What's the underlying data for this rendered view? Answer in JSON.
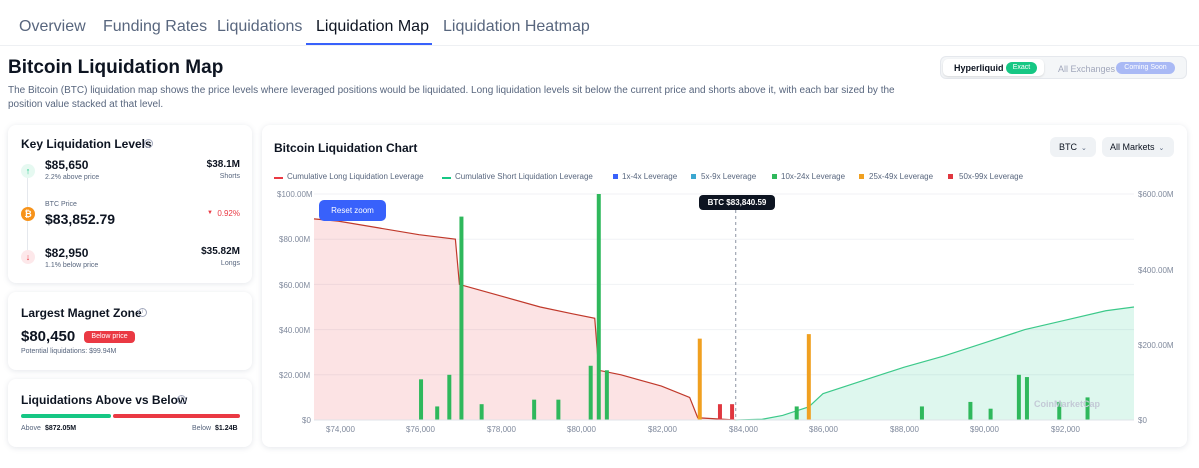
{
  "tabs": [
    {
      "label": "Overview"
    },
    {
      "label": "Funding Rates"
    },
    {
      "label": "Liquidations"
    },
    {
      "label": "Liquidation Map",
      "active": true
    },
    {
      "label": "Liquidation Heatmap"
    }
  ],
  "page": {
    "title": "Bitcoin Liquidation Map",
    "description": "The Bitcoin (BTC) liquidation map shows the price levels where leveraged positions would be liquidated. Long liquidation levels sit below the current price and shorts above it, with each bar sized by the position value stacked at that level."
  },
  "source_toggle": {
    "hyperliquid": "Hyperliquid",
    "exact_badge": "Exact",
    "all_exchanges": "All Exchanges",
    "coming_soon": "Coming Soon"
  },
  "key_levels": {
    "title": "Key Liquidation Levels",
    "upper": {
      "price": "$85,650",
      "sub": "2.2% above price",
      "value": "$38.1M",
      "value_label": "Shorts"
    },
    "current": {
      "label": "BTC Price",
      "price": "$83,852.79",
      "change": "0.92%"
    },
    "lower": {
      "price": "$82,950",
      "sub": "1.1% below price",
      "value": "$35.82M",
      "value_label": "Longs"
    }
  },
  "magnet": {
    "title": "Largest Magnet Zone",
    "price": "$80,450",
    "badge": "Below price",
    "potential": "Potential liquidations: $99.94M"
  },
  "above_below": {
    "title": "Liquidations Above vs Below",
    "above_label": "Above",
    "above_value": "$872.05M",
    "below_label": "Below",
    "below_value": "$1.24B",
    "above_fraction": 0.41
  },
  "chart": {
    "title": "Bitcoin Liquidation Chart",
    "coin_select": "BTC",
    "market_select": "All Markets",
    "reset_zoom": "Reset zoom",
    "price_tag": "BTC $83,840.59",
    "watermark": "CoinMarketCap",
    "left_ticks": [
      "$100.00M",
      "$80.00M",
      "$60.00M",
      "$40.00M",
      "$20.00M",
      "$0"
    ],
    "right_ticks": [
      "$600.00M",
      "$400.00M",
      "$200.00M",
      "$0"
    ],
    "x_ticks": [
      "$74,000",
      "$76,000",
      "$78,000",
      "$80,000",
      "$82,000",
      "$84,000",
      "$86,000",
      "$88,000",
      "$90,000",
      "$92,000"
    ],
    "legend": [
      {
        "label": "Cumulative Long Liquidation Leverage",
        "color": "#ea3943",
        "kind": "line"
      },
      {
        "label": "Cumulative Short Liquidation Leverage",
        "color": "#16c784",
        "kind": "line"
      },
      {
        "label": "1x-4x Leverage",
        "color": "#3861fb",
        "kind": "square"
      },
      {
        "label": "5x-9x Leverage",
        "color": "#3ba7d0",
        "kind": "square"
      },
      {
        "label": "10x-24x Leverage",
        "color": "#2fb85c",
        "kind": "square"
      },
      {
        "label": "25x-49x Leverage",
        "color": "#f0a020",
        "kind": "square"
      },
      {
        "label": "50x-99x Leverage",
        "color": "#e0373f",
        "kind": "square"
      }
    ]
  },
  "chart_data": {
    "type": "bar",
    "x_range": [
      73400,
      93700
    ],
    "left_ylim": [
      0,
      100
    ],
    "right_ylim": [
      0,
      600
    ],
    "current_price": 83840.59,
    "bars": [
      {
        "x": 76050,
        "v": 18,
        "c": "#2fb85c"
      },
      {
        "x": 76450,
        "v": 6,
        "c": "#2fb85c"
      },
      {
        "x": 76750,
        "v": 20,
        "c": "#2fb85c"
      },
      {
        "x": 77050,
        "v": 90,
        "c": "#2fb85c"
      },
      {
        "x": 77550,
        "v": 7,
        "c": "#2fb85c"
      },
      {
        "x": 78850,
        "v": 9,
        "c": "#2fb85c"
      },
      {
        "x": 79450,
        "v": 9,
        "c": "#2fb85c"
      },
      {
        "x": 80250,
        "v": 24,
        "c": "#2fb85c"
      },
      {
        "x": 80450,
        "v": 100,
        "c": "#2fb85c"
      },
      {
        "x": 80650,
        "v": 22,
        "c": "#2fb85c"
      },
      {
        "x": 82950,
        "v": 36,
        "c": "#f0a020"
      },
      {
        "x": 83450,
        "v": 7,
        "c": "#e0373f"
      },
      {
        "x": 83750,
        "v": 7,
        "c": "#e0373f"
      },
      {
        "x": 85650,
        "v": 38,
        "c": "#f0a020"
      },
      {
        "x": 85350,
        "v": 6,
        "c": "#2fb85c"
      },
      {
        "x": 88450,
        "v": 6,
        "c": "#2fb85c"
      },
      {
        "x": 89650,
        "v": 8,
        "c": "#2fb85c"
      },
      {
        "x": 90150,
        "v": 5,
        "c": "#2fb85c"
      },
      {
        "x": 90850,
        "v": 20,
        "c": "#2fb85c"
      },
      {
        "x": 91050,
        "v": 19,
        "c": "#2fb85c"
      },
      {
        "x": 91850,
        "v": 8,
        "c": "#2fb85c"
      },
      {
        "x": 92550,
        "v": 10,
        "c": "#2fb85c"
      }
    ],
    "long_cumulative": [
      [
        73400,
        89
      ],
      [
        74000,
        88
      ],
      [
        75000,
        85
      ],
      [
        76000,
        82
      ],
      [
        76900,
        80
      ],
      [
        77000,
        60
      ],
      [
        78000,
        55
      ],
      [
        79000,
        50
      ],
      [
        79800,
        47
      ],
      [
        80350,
        45
      ],
      [
        80450,
        22
      ],
      [
        81000,
        20
      ],
      [
        82000,
        15
      ],
      [
        82700,
        10
      ],
      [
        82900,
        1
      ],
      [
        83840,
        0
      ]
    ],
    "short_cumulative": [
      [
        83840,
        0
      ],
      [
        84500,
        2
      ],
      [
        85000,
        12
      ],
      [
        85650,
        35
      ],
      [
        86000,
        70
      ],
      [
        87000,
        105
      ],
      [
        88000,
        140
      ],
      [
        89000,
        170
      ],
      [
        90000,
        205
      ],
      [
        91000,
        240
      ],
      [
        92000,
        265
      ],
      [
        93000,
        290
      ],
      [
        93700,
        300
      ]
    ]
  }
}
